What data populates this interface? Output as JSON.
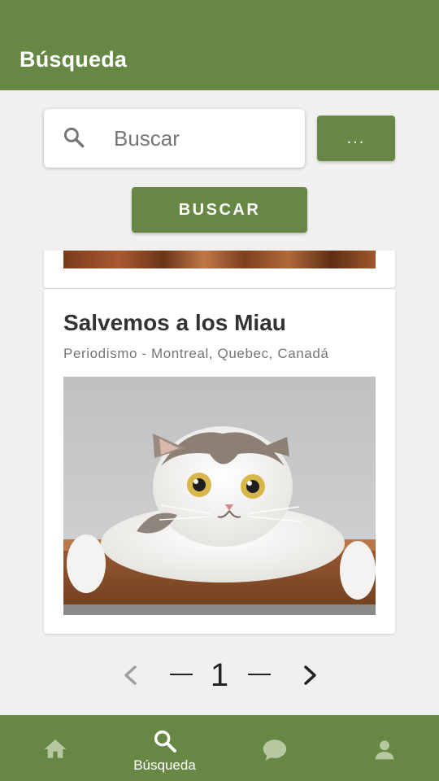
{
  "app_bar": {
    "title": "Búsqueda"
  },
  "search": {
    "placeholder": "Buscar",
    "value": "",
    "icon": "search-icon",
    "more_label": "...",
    "submit_label": "BUSCAR"
  },
  "results": [
    {
      "title": "Salvemos a los Miau",
      "subtitle": "Periodismo - Montreal, Quebec, Canadá",
      "image": "cat-photo"
    }
  ],
  "pagination": {
    "current_page": "1"
  },
  "bottom_nav": {
    "items": [
      {
        "icon": "home-icon",
        "label": "",
        "active": false
      },
      {
        "icon": "search-icon",
        "label": "Búsqueda",
        "active": true
      },
      {
        "icon": "chat-icon",
        "label": "",
        "active": false
      },
      {
        "icon": "person-icon",
        "label": "",
        "active": false
      }
    ]
  },
  "colors": {
    "primary": "#668844",
    "background": "#F0F0F0",
    "inactive_icon": "#B5C8A0"
  }
}
